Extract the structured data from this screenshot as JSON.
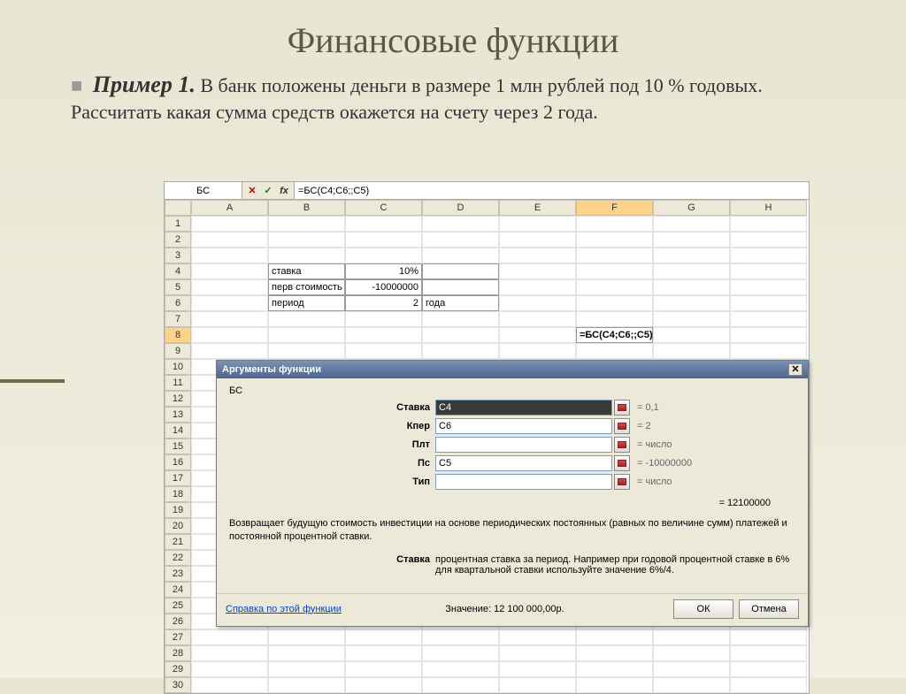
{
  "slide": {
    "title": "Финансовые функции",
    "example_label": "Пример 1.",
    "text": "В банк положены деньги в размере 1 млн рублей под 10 % годовых. Рассчитать какая сумма средств окажется на счету через 2 года."
  },
  "spreadsheet": {
    "name_box": "БС",
    "formula": "=БС(C4;C6;;C5)",
    "columns": [
      "A",
      "B",
      "C",
      "D",
      "E",
      "F",
      "G",
      "H"
    ],
    "cells": {
      "b4": "ставка",
      "c4": "10%",
      "b5": "перв стоимость",
      "c5": "-10000000",
      "b6": "период",
      "c6": "2",
      "d6": "года",
      "f8": "=БС(C4;C6;;C5)"
    }
  },
  "dialog": {
    "title": "Аргументы функции",
    "func_name": "БС",
    "args": [
      {
        "label": "Ставка",
        "value": "C4",
        "result": "= 0,1",
        "dark": true
      },
      {
        "label": "Кпер",
        "value": "C6",
        "result": "= 2",
        "dark": false
      },
      {
        "label": "Плт",
        "value": "",
        "result": "= число",
        "dark": false
      },
      {
        "label": "Пс",
        "value": "C5",
        "result": "= -10000000",
        "dark": false
      },
      {
        "label": "Тип",
        "value": "",
        "result": "= число",
        "dark": false
      }
    ],
    "result": "= 12100000",
    "description": "Возвращает будущую стоимость инвестиции на основе периодических постоянных (равных по величине сумм) платежей и постоянной процентной ставки.",
    "param": {
      "label": "Ставка",
      "text": "процентная ставка за период. Например при годовой процентной ставке в 6% для квартальной ставки используйте значение 6%/4."
    },
    "help": "Справка по этой функции",
    "value_label": "Значение: 12 100 000,00р.",
    "ok": "ОК",
    "cancel": "Отмена"
  }
}
